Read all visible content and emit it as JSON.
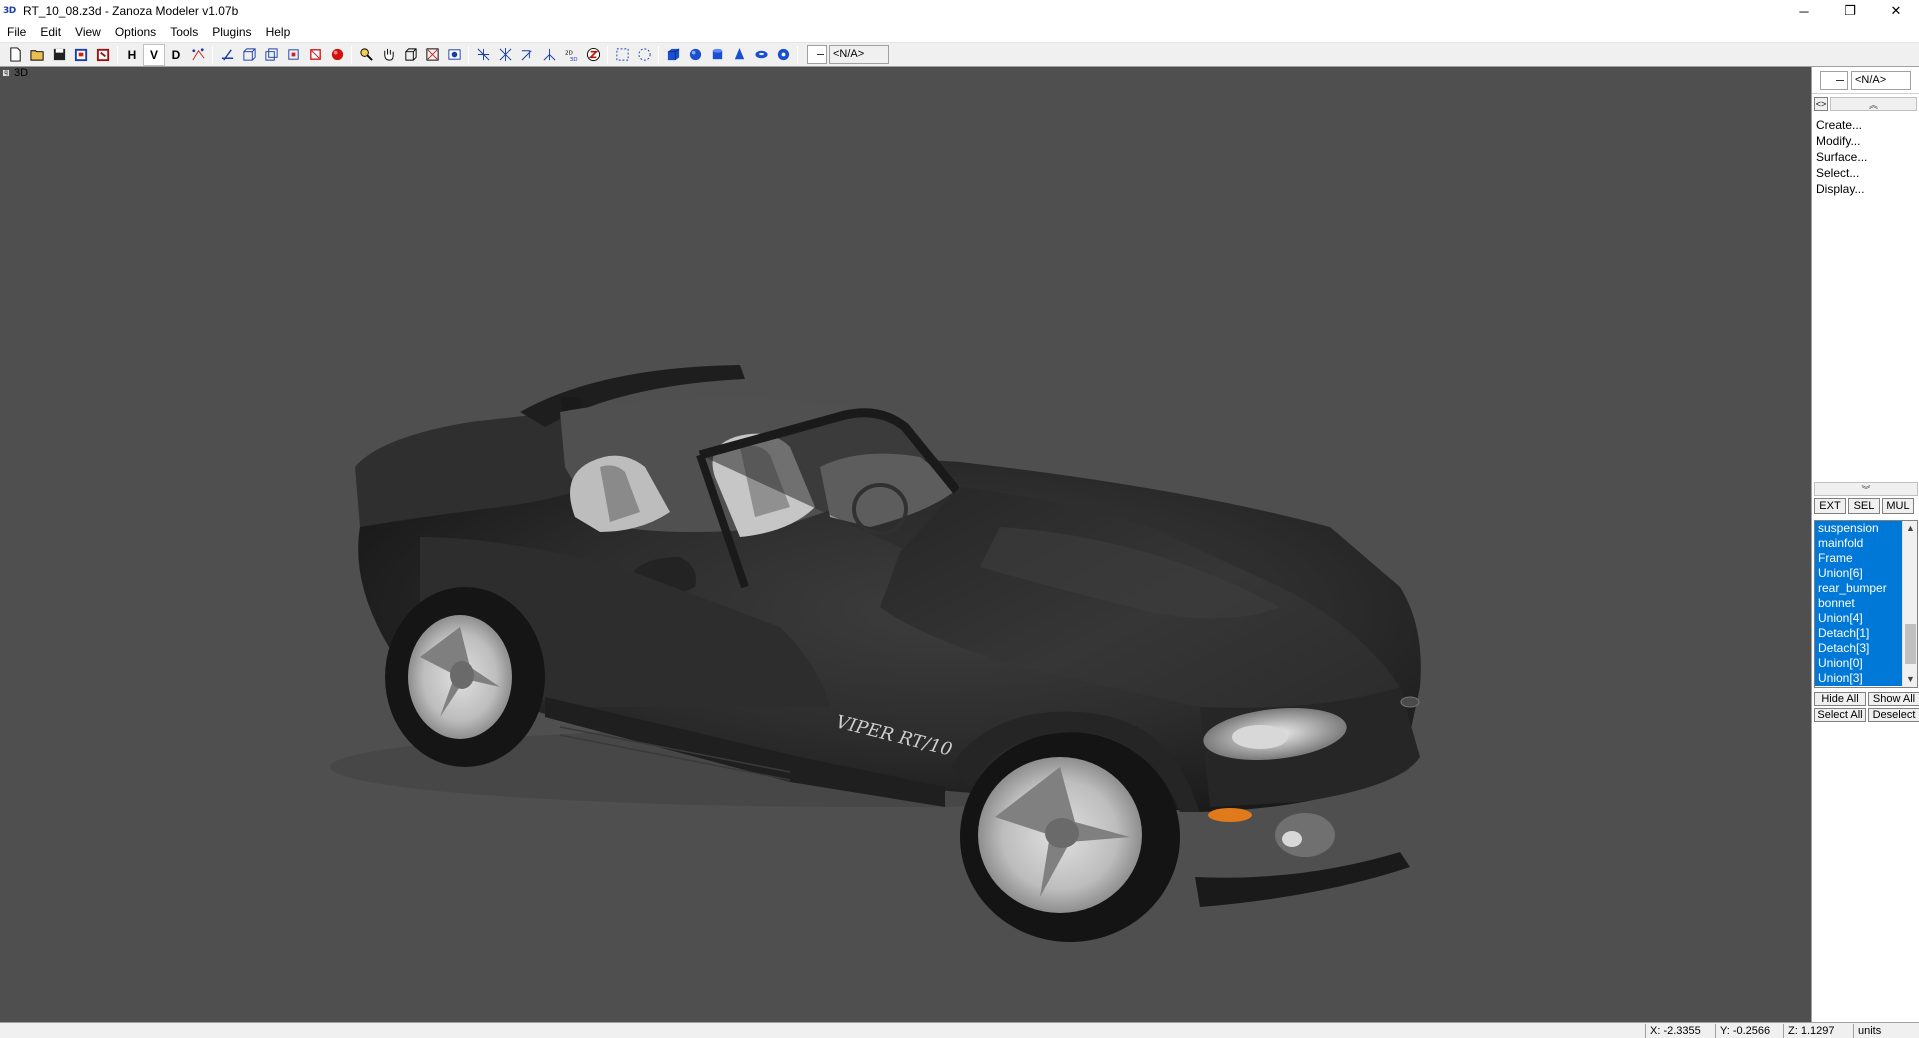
{
  "window": {
    "app_icon_text": "3D",
    "title": "RT_10_08.z3d - Zanoza Modeler v1.07b",
    "controls": {
      "minimize": "─",
      "maximize": "❐",
      "close": "✕"
    }
  },
  "menu": [
    "File",
    "Edit",
    "View",
    "Options",
    "Tools",
    "Plugins",
    "Help"
  ],
  "toolbar": {
    "text_buttons": {
      "h": "H",
      "v": "V",
      "d": "D"
    },
    "selector_value": "<N/A>"
  },
  "viewport": {
    "label": "3D",
    "corner_marker": "q",
    "background": "#4f4f4f",
    "car_badge": "VIPER RT/10"
  },
  "right_panel": {
    "selector_value": "<N/A>",
    "toggle_label": "<>",
    "menu": [
      "Create...",
      "Modify...",
      "Surface...",
      "Select...",
      "Display..."
    ],
    "modes": [
      "EXT",
      "SEL",
      "MUL"
    ],
    "objects": [
      "suspension",
      "mainfold",
      "Frame",
      "Union[6]",
      "rear_bumper",
      "bonnet",
      "Union[4]",
      "Detach[1]",
      "Detach[3]",
      "Union[0]",
      "Union[3]"
    ],
    "buttons": [
      "Hide All",
      "Show All",
      "Select All",
      "Deselect"
    ],
    "selection_color": "#0078d7"
  },
  "status": {
    "x": "X: -2.3355",
    "y": "Y: -0.2566",
    "z": "Z: 1.1297",
    "units": "units"
  }
}
